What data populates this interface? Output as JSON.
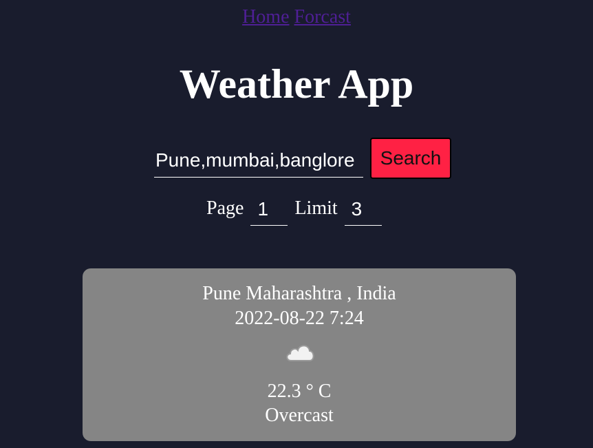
{
  "nav": {
    "home_label": "Home",
    "forcast_label": "Forcast",
    "link_color": "#4f1f96"
  },
  "header": {
    "title": "Weather App"
  },
  "search": {
    "value": "Pune,mumbai,banglore",
    "button_label": "Search",
    "button_color": "#ff2144"
  },
  "pagination": {
    "page_label": "Page",
    "page_value": "1",
    "limit_label": "Limit",
    "limit_value": "3"
  },
  "weather_card": {
    "location": "Pune Maharashtra , India",
    "datetime": "2022-08-22 7:24",
    "icon": "cloud-icon",
    "temperature": "22.3 ° C",
    "condition": "Overcast",
    "background_color": "#858585"
  },
  "theme": {
    "background": "#191c2d",
    "text": "#ffffff"
  }
}
